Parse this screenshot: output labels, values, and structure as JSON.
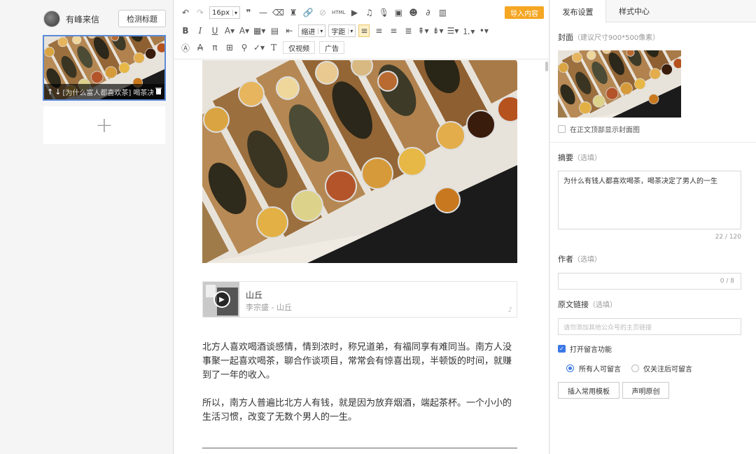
{
  "sidebar": {
    "account_name": "有峰来信",
    "detect_button": "检测标题",
    "article_title": "[为什么富人都喜欢茶] 喝茶决定",
    "add_icon": "+"
  },
  "toolbar": {
    "font_size": "16px",
    "indent": "缩进",
    "letter_spacing": "字距",
    "import_button": "导入内容",
    "video_only": "仅视频",
    "ad": "广告",
    "html": "HTML",
    "icons": [
      "undo-icon",
      "redo-icon",
      "quote-icon",
      "hr-icon",
      "eraser-icon",
      "format-brush-icon",
      "link-icon",
      "unlink-icon",
      "video-icon",
      "music-icon",
      "audio-icon",
      "image-icon",
      "emoji-icon",
      "mini-program-icon",
      "chart-icon"
    ]
  },
  "editor": {
    "music_title": "山丘",
    "music_artist": "李宗盛 - 山丘",
    "paragraph1": "北方人喜欢喝酒谈感情，情到浓时，称兄道弟，有福同享有难同当。南方人没事聚一起喜欢喝茶，聊合作谈项目，常常会有惊喜出现，半顿饭的时间，就赚到了一年的收入。",
    "paragraph2": "所以，南方人普遍比北方人有钱，就是因为放弃烟酒，端起茶杯。一个小小的生活习惯，改变了无数个男人的一生。"
  },
  "settings": {
    "tab_publish": "发布设置",
    "tab_style": "样式中心",
    "cover_label": "封面",
    "cover_hint": "（建议尺寸900*500像素）",
    "show_cover_label": "在正文顶部显示封面图",
    "summary_label": "摘要",
    "summary_optional": "（选填）",
    "summary_value": "为什么有钱人都喜欢喝茶，喝茶决定了男人的一生",
    "summary_count": "22 / 120",
    "author_label": "作者",
    "author_optional": "（选填）",
    "author_count": "0 / 8",
    "source_label": "原文链接",
    "source_optional": "（选填）",
    "source_placeholder": "请勿添加其他公众号的主页链接",
    "comment_label": "打开留言功能",
    "comment_all": "所有人可留言",
    "comment_followers": "仅关注后可留言",
    "insert_template": "插入常用模板",
    "declare_original": "声明原创"
  },
  "colors": {
    "accent": "#3b78e7",
    "import": "#f5a623"
  }
}
